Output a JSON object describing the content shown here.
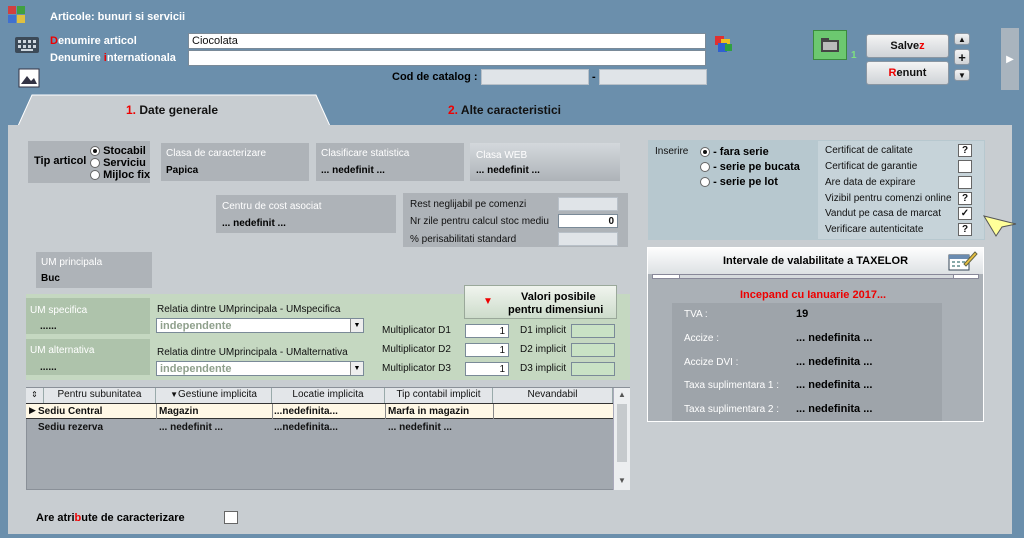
{
  "window": {
    "title": "Articole: bunuri si servicii"
  },
  "header": {
    "denumire_label_pre": "",
    "denumire_label_hl": "D",
    "denumire_label_post": "enumire articol",
    "denumire_value": "Ciocolata",
    "intl_label_pre": "Denumire ",
    "intl_label_hl": "i",
    "intl_label_post": "nternationala",
    "intl_value": "",
    "catalog_label": "Cod de catalog :",
    "catalog_sep": "-",
    "counter": "1",
    "save_pre": "Salve",
    "save_hl": "z",
    "cancel_hl": "R",
    "cancel_post": "enunt"
  },
  "tabs": [
    {
      "num": "1.",
      "label": " Date generale"
    },
    {
      "num": "2.",
      "label": " Alte caracteristici"
    }
  ],
  "tip_articol": {
    "label": "Tip articol",
    "options": [
      "Stocabil",
      "Serviciu",
      "Mijloc fix"
    ],
    "selected": "Stocabil"
  },
  "clasa_caracterizare": {
    "label": "Clasa de caracterizare",
    "value": "Papica"
  },
  "clasificare_statistica": {
    "label": "Clasificare statistica",
    "value": "... nedefinit ..."
  },
  "clasa_web": {
    "label": "Clasa WEB",
    "value": "... nedefinit ..."
  },
  "centru_cost": {
    "label": "Centru de cost asociat",
    "value": "... nedefinit ..."
  },
  "stock": {
    "rest_label": "Rest neglijabil pe comenzi",
    "rest_value": "",
    "zile_label": "Nr zile pentru calcul stoc mediu",
    "zile_value": "0",
    "perisabilitati_label": "% perisabilitati standard",
    "perisabilitati_value": ""
  },
  "um_principala": {
    "label": "UM principala",
    "value": "Buc"
  },
  "um_specifica": {
    "label": "UM specifica",
    "value": "......",
    "relatie_label": "Relatia dintre UMprincipala - UMspecifica",
    "relatie_value": "independente"
  },
  "um_alternativa": {
    "label": "UM alternativa",
    "value": "......",
    "relatie_label": "Relatia dintre UMprincipala - UMalternativa",
    "relatie_value": "independente"
  },
  "valori": {
    "line1": "Valori posibile",
    "line2": "pentru dimensiuni"
  },
  "multiplicatori": [
    {
      "label": "Multiplicator D1",
      "value": "1",
      "implicit_label": "D1 implicit",
      "implicit_value": ""
    },
    {
      "label": "Multiplicator D2",
      "value": "1",
      "implicit_label": "D2 implicit",
      "implicit_value": ""
    },
    {
      "label": "Multiplicator D3",
      "value": "1",
      "implicit_label": "D3 implicit",
      "implicit_value": ""
    }
  ],
  "table": {
    "headers": [
      "Pentru subunitatea",
      "Gestiune implicita",
      "Locatie implicita",
      "Tip contabil implicit",
      "Nevandabil"
    ],
    "rows": [
      [
        "Sediu Central",
        "Magazin",
        "...nedefinita...",
        "Marfa in magazin",
        ""
      ],
      [
        "Sediu rezerva",
        "... nedefinit ...",
        "...nedefinita...",
        "... nedefinit ...",
        ""
      ]
    ]
  },
  "atribute": {
    "label_pre": "Are atri",
    "label_hl": "b",
    "label_post": "ute de caracterizare"
  },
  "inserire": {
    "label": "Inserire",
    "options": [
      "- fara serie",
      "- serie pe bucata",
      "- serie pe lot"
    ],
    "selected": "- fara serie"
  },
  "checks": [
    {
      "label": "Certificat de calitate",
      "mark": "?"
    },
    {
      "label": "Certificat de garantie",
      "mark": ""
    },
    {
      "label": "Are data de expirare",
      "mark": ""
    },
    {
      "label": "Vizibil pentru comenzi online",
      "mark": "?"
    },
    {
      "label": "Vandut pe casa de marcat",
      "mark": "✓"
    },
    {
      "label": "Verificare autenticitate",
      "mark": "?"
    }
  ],
  "taxe": {
    "title": "Intervale de valabilitate a TAXELOR",
    "period": "Incepand cu Ianuarie 2017...",
    "items": [
      {
        "label": "TVA  :",
        "value": "19"
      },
      {
        "label": "Accize  :",
        "value": "... nedefinita ..."
      },
      {
        "label": "Accize DVI :",
        "value": "... nedefinita ..."
      },
      {
        "label": "Taxa suplimentara 1 :",
        "value": "... nedefinita ..."
      },
      {
        "label": "Taxa suplimentara 2 :",
        "value": "... nedefinita ..."
      }
    ]
  },
  "colors": {
    "accent_red": "#e00000",
    "window_blue": "#6b8fac",
    "panel_grey": "#c8cdd1",
    "green_panel": "#c5d8c1"
  }
}
